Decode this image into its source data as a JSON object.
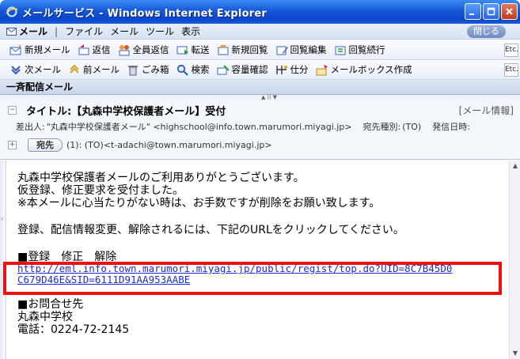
{
  "window": {
    "title": "メールサービス - Windows Internet Explorer",
    "controls": [
      "minimize",
      "maximize",
      "close"
    ]
  },
  "menubar": {
    "mail_label": "メール",
    "separator": "|",
    "items": [
      "ファイル",
      "メール",
      "ツール",
      "表示"
    ],
    "close_label": "閉じる"
  },
  "toolbar1": {
    "items": [
      {
        "label": "新規メール",
        "icon": "new-mail-icon"
      },
      {
        "label": "返信",
        "icon": "reply-icon"
      },
      {
        "label": "全員返信",
        "icon": "reply-all-icon"
      },
      {
        "label": "転送",
        "icon": "forward-icon"
      },
      {
        "label": "新規回覧",
        "icon": "new-circulation-icon"
      },
      {
        "label": "回覧編集",
        "icon": "edit-circulation-icon"
      },
      {
        "label": "回覧続行",
        "icon": "continue-circulation-icon"
      }
    ],
    "etc_label": "Etc."
  },
  "toolbar2": {
    "items": [
      {
        "label": "次メール",
        "icon": "next-mail-icon"
      },
      {
        "label": "前メール",
        "icon": "prev-mail-icon"
      },
      {
        "label": "ごみ箱",
        "icon": "trash-icon"
      },
      {
        "label": "検索",
        "icon": "search-icon"
      },
      {
        "label": "容量確認",
        "icon": "capacity-icon"
      },
      {
        "label": "仕分",
        "icon": "sort-icon"
      },
      {
        "label": "メールボックス作成",
        "icon": "create-mailbox-icon"
      }
    ],
    "etc_label": "Etc."
  },
  "section": {
    "title": "一斉配信メール"
  },
  "message_header": {
    "subject": "タイトル:【丸森中学校保護者メール】受付",
    "info_link": "[メール情報]",
    "from_label": "差出人:",
    "from_value": "\"丸森中学校保護者メール\" <highschool@info.town.marumori.miyagi.jp>",
    "type_label": "宛先種別:",
    "type_value": "(TO)",
    "sent_label": "発信日時:",
    "to_button": "宛先",
    "to_value": "(1): (TO)<t-adachi@town.marumori.miyagi.jp>"
  },
  "message_body": {
    "intro_lines": [
      "丸森中学校保護者メールのご利用ありがとうございます。",
      "仮登録、修正要求を受付ました。",
      "※本メールに心当たりがない時は、お手数ですが削除をお願い致します。"
    ],
    "instruction": "登録、配信情報変更、解除されるには、下記のURLをクリックしてください。",
    "link_heading": "■登録　修正　解除",
    "url_line1": "http://eml.info.town.marumori.miyagi.jp/public/regist/top.do?UID=8C7B45D0",
    "url_line2": "C679D46E&SID=6111D91AA953AABE",
    "contact_heading": "■お問合せ先",
    "contact_name": "丸森中学校",
    "contact_phone": "電話：0224-72-2145"
  },
  "colors": {
    "titlebar": "#1657d8",
    "link": "#1a2fd0",
    "highlight": "#ee1111"
  }
}
